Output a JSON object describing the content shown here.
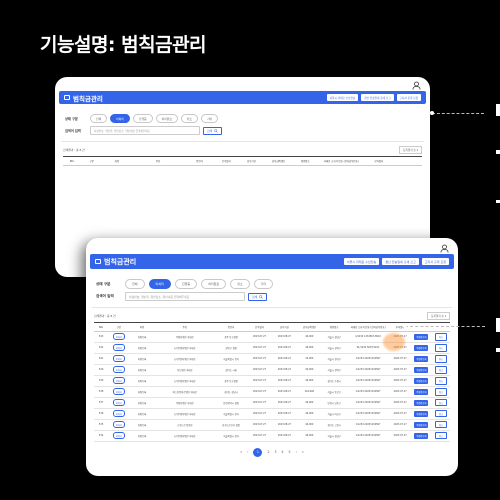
{
  "heading": "기능설명: 범칙금관리",
  "app": {
    "title": "범칙금관리",
    "toolbar_buttons": [
      "서울시 과태료 수납전송",
      "결산 전송일세 출세 신고",
      "고지서 출력 요청"
    ],
    "filters": {
      "status_label": "상태 구분",
      "status_options": [
        "전체",
        "미처리",
        "진행중",
        "처리완료",
        "취소",
        "기타"
      ],
      "status_active_index": 1,
      "keyword_label": "검색어 입력",
      "keyword_placeholder": "차량번호, 위반일, 위반장소, 위반내용 입력해주세요",
      "search_label": "검색"
    },
    "total_label": "검색결과 : 총 8 건",
    "sort_label": "등록일자 순 ▾",
    "columns": [
      "NO.",
      "구분",
      "차량",
      "주유",
      "운전자",
      "단속일자",
      "납부기한",
      "납부금액(원)",
      "위반장소",
      "과태료 고지서 번호 (전자납부번호)",
      "부과일자",
      "",
      ""
    ],
    "rows": [
      [
        "543",
        "미처리",
        "차량등록",
        "주정차위반 과태료",
        "광주 동구청장",
        "2023.07.27",
        "2023.08.27",
        "40,000",
        "서울시 강남구",
        "1/1234 1234567-8910",
        "2023.07.27",
        "주정차등록",
        "취소"
      ],
      [
        "542",
        "미처리",
        "차량등록",
        "(구)주정차위반 과태료",
        "성북구 청장",
        "2023.07.27",
        "2023.08.27",
        "40,000",
        "서울시 성북구",
        "01/1234 5678 9101",
        "2023.07.27",
        "주정차등록",
        "취소"
      ],
      [
        "541",
        "미처리",
        "차량등록",
        "(구)주정차위반 과태료",
        "서울특별시 관리",
        "2023.07.27",
        "2023.08.27",
        "32,000",
        "서울시 강서구",
        "1/1234 20231234567",
        "2023.07.27",
        "주정차등록",
        "취소"
      ],
      [
        "540",
        "미처리",
        "차량등록",
        "속도위반 과태료",
        "경기도 시흥",
        "2023.07.27",
        "2023.08.27",
        "40,000",
        "서울시 관악구",
        "1/1234 20231234567",
        "2023.07.27",
        "주정차등록",
        "취소"
      ],
      [
        "539",
        "미처리",
        "차량등록",
        "(구)주정차위반 과태료",
        "광주 동구청장",
        "2023.07.27",
        "2023.08.27",
        "40,000",
        "경기도 수원시",
        "1/1234 20231234567",
        "2023.07.27",
        "주정차등록",
        "취소"
      ],
      [
        "538",
        "미처리",
        "차량등록",
        "버스전용차로위반 과태료",
        "경기도 성남시",
        "2023.07.27",
        "2023.08.27",
        "144,000",
        "서울시 종로구",
        "1/1234 20231234567",
        "2023.07.27",
        "주정차등록",
        "취소"
      ],
      [
        "537",
        "미처리",
        "차량등록",
        "주정차위반 과태료",
        "인천광역시 청장",
        "2023.07.27",
        "2023.08.27",
        "40,000",
        "인천시 남동구",
        "1/1234 20231234567",
        "2023.07.27",
        "주정차등록",
        "취소"
      ],
      [
        "536",
        "미처리",
        "차량등록",
        "(구)주정차위반 과태료",
        "서울특별시 관리",
        "2023.07.27",
        "2023.08.27",
        "40,000",
        "서울시 마포구",
        "1/1234 20231234567",
        "2023.07.27",
        "주정차등록",
        "취소"
      ],
      [
        "535",
        "미처리",
        "차량등록",
        "고속도로 통행료",
        "한국도로공사 청장",
        "2023.07.27",
        "2023.08.27",
        "40,000",
        "경기도 고양시",
        "1/1234 20231234567",
        "2023.07.27",
        "주정차등록",
        "취소"
      ],
      [
        "534",
        "미처리",
        "차량등록",
        "(구)주정차위반 과태료",
        "서울특별시 관리",
        "2023.07.27",
        "2023.08.27",
        "40,000",
        "서울시 강남구",
        "1/1234 20231234567",
        "2023.07.27",
        "주정차등록",
        "취소"
      ]
    ],
    "pagination": [
      "«",
      "‹",
      "1",
      "2",
      "3",
      "4",
      "5",
      "›",
      "»"
    ],
    "current_page_index": 2
  },
  "colors": {
    "accent": "#3465e8",
    "highlight": "#ff8c28",
    "background": "#000000"
  },
  "icons": [
    "monitor-icon",
    "user-icon",
    "search-icon"
  ]
}
